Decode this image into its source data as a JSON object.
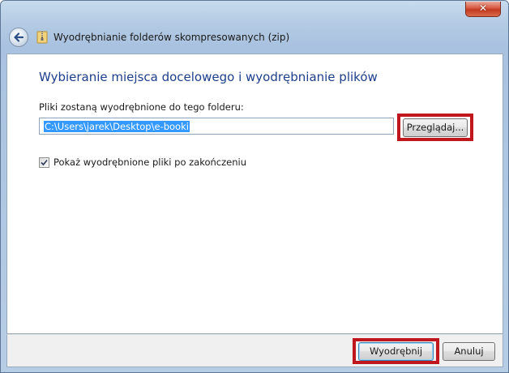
{
  "window": {
    "title": "Wyodrębnianie folderów skompresowanych (zip)",
    "close_glyph": "✕"
  },
  "icons": {
    "back": "back-arrow-icon",
    "zip_folder": "zip-folder-icon",
    "close": "close-icon",
    "check": "checkmark-icon"
  },
  "content": {
    "heading": "Wybieranie miejsca docelowego i wyodrębnianie plików",
    "destination_label": "Pliki zostaną wyodrębnione do tego folderu:",
    "destination_value": "C:\\Users\\jarek\\Desktop\\e-booki",
    "browse_label": "Przeglądaj...",
    "show_files_label": "Pokaż wyodrębnione pliki po zakończeniu",
    "show_files_checked": true
  },
  "footer": {
    "extract_label": "Wyodrębnij",
    "cancel_label": "Anuluj"
  },
  "colors": {
    "heading": "#1d3f8c",
    "highlight_box": "#c0161d",
    "selection": "#3399ff"
  }
}
